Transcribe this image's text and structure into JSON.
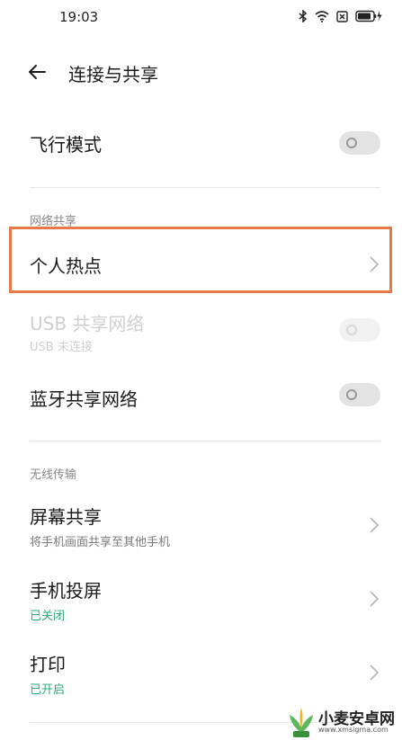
{
  "status": {
    "time": "19:03"
  },
  "header": {
    "title": "连接与共享"
  },
  "airplane": {
    "label": "飞行模式"
  },
  "network_share": {
    "section": "网络共享",
    "hotspot": {
      "label": "个人热点"
    },
    "usb": {
      "label": "USB 共享网络",
      "sub": "USB 未连接"
    },
    "bluetooth": {
      "label": "蓝牙共享网络"
    }
  },
  "wireless": {
    "section": "无线传输",
    "screen_share": {
      "label": "屏幕共享",
      "sub": "将手机画面共享至其他手机"
    },
    "cast": {
      "label": "手机投屏",
      "sub": "已关闭"
    },
    "print": {
      "label": "打印",
      "sub": "已开启"
    }
  },
  "colors": {
    "highlight": "#e8774a",
    "status_green": "#2aa87a"
  },
  "watermark": {
    "text": "小麦安卓网",
    "url": "www.xmsigma.com"
  }
}
